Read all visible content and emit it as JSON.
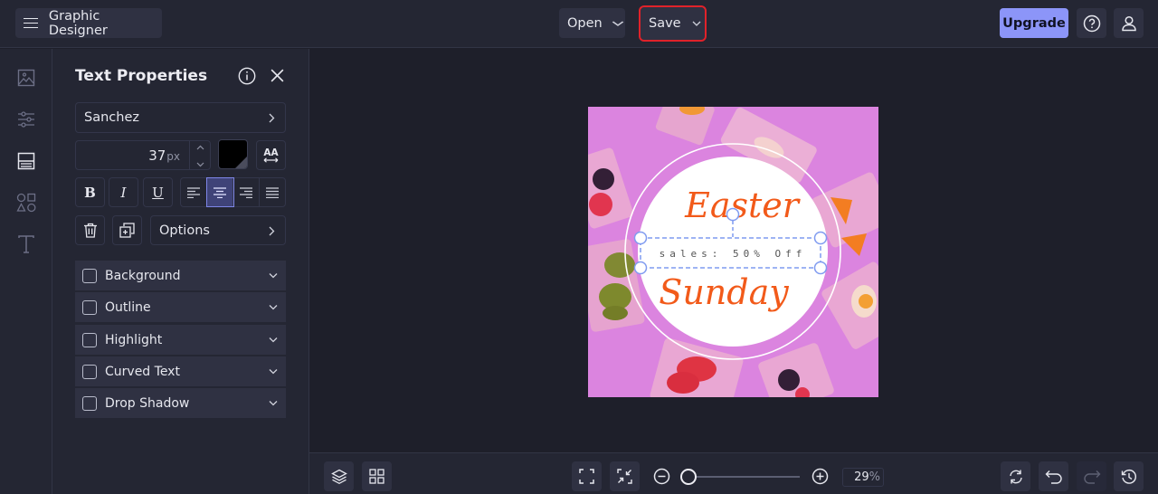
{
  "topbar": {
    "app_title": "Graphic Designer",
    "open_label": "Open",
    "save_label": "Save",
    "upgrade_label": "Upgrade",
    "icons": {
      "menu": "hamburger-icon",
      "help": "question-circle-icon",
      "user": "user-icon"
    }
  },
  "rail": {
    "items": [
      {
        "name": "images",
        "icon": "image-icon"
      },
      {
        "name": "adjustments",
        "icon": "sliders-icon"
      },
      {
        "name": "layout",
        "icon": "layout-icon",
        "active": true
      },
      {
        "name": "shapes",
        "icon": "shapes-icon"
      },
      {
        "name": "text",
        "icon": "text-icon"
      }
    ]
  },
  "panel": {
    "title": "Text Properties",
    "font_name": "Sanchez",
    "font_size": "37",
    "font_size_unit": "px",
    "text_color": "#000000",
    "format_buttons": [
      "B",
      "I",
      "U"
    ],
    "alignment": [
      "left",
      "center",
      "right",
      "justify"
    ],
    "active_alignment": "center",
    "options_label": "Options",
    "accordions": [
      {
        "label": "Background",
        "checked": false
      },
      {
        "label": "Outline",
        "checked": false
      },
      {
        "label": "Highlight",
        "checked": false
      },
      {
        "label": "Curved Text",
        "checked": false
      },
      {
        "label": "Drop Shadow",
        "checked": false
      }
    ]
  },
  "canvas": {
    "background_color": "#db84df",
    "headline_top": "Easter",
    "selected_text": "sales: 50% Off",
    "headline_bottom": "Sunday",
    "accent_color": "#f25a1a",
    "selection_color": "#7f9bf0"
  },
  "bottombar": {
    "zoom_percent": "29",
    "zoom_unit": "%",
    "zoom_level_fraction": 0.05,
    "icons": [
      "layers-icon",
      "grid-icon",
      "fit-screen-icon",
      "shrink-icon",
      "zoom-out-icon",
      "zoom-in-icon",
      "refresh-icon",
      "undo-icon",
      "redo-icon",
      "history-icon"
    ]
  }
}
